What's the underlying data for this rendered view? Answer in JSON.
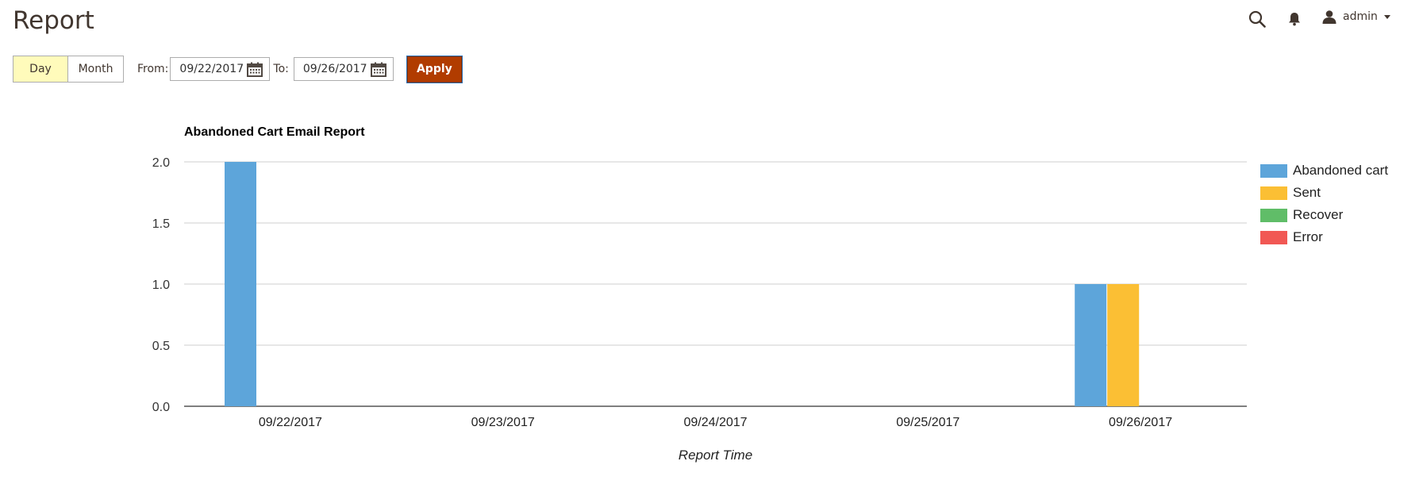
{
  "page": {
    "title": "Report"
  },
  "header": {
    "search_icon": "search-icon",
    "notifications_icon": "bell-icon",
    "user": {
      "name": "admin",
      "icon": "user-icon"
    }
  },
  "toolbar": {
    "periods": {
      "day": "Day",
      "month": "Month",
      "selected": "Day"
    },
    "from_label": "From:",
    "from_value": "09/22/2017",
    "to_label": "To:",
    "to_value": "09/26/2017",
    "apply_label": "Apply",
    "calendar_icon": "calendar-icon"
  },
  "colors": {
    "accent": "#b13c00",
    "active_period_bg": "#fffbbb"
  },
  "chart_data": {
    "type": "bar",
    "title": "Abandoned Cart Email Report",
    "xlabel": "Report Time",
    "ylabel": "",
    "ylim": [
      0,
      2.0
    ],
    "yticks": [
      "0.0",
      "0.5",
      "1.0",
      "1.5",
      "2.0"
    ],
    "grid": true,
    "legend_position": "right",
    "categories": [
      "09/22/2017",
      "09/23/2017",
      "09/24/2017",
      "09/25/2017",
      "09/26/2017"
    ],
    "series": [
      {
        "name": "Abandoned cart",
        "color": "#5da5da",
        "values": [
          2,
          0,
          0,
          0,
          1
        ]
      },
      {
        "name": "Sent",
        "color": "#fbbf34",
        "values": [
          0,
          0,
          0,
          0,
          1
        ]
      },
      {
        "name": "Recover",
        "color": "#60bd68",
        "values": [
          0,
          0,
          0,
          0,
          0
        ]
      },
      {
        "name": "Error",
        "color": "#f15854",
        "values": [
          0,
          0,
          0,
          0,
          0
        ]
      }
    ]
  }
}
